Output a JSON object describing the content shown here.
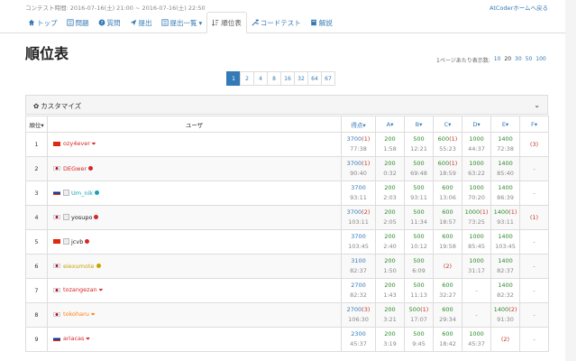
{
  "header": {
    "contest_time": "コンテスト時間: 2016-07-16(土) 21:00 ~ 2016-07-16(土) 22:50",
    "home_link": "AtCoderホームへ戻る"
  },
  "nav": [
    {
      "label": "トップ",
      "icon": "home-icon"
    },
    {
      "label": "問題",
      "icon": "list-icon"
    },
    {
      "label": "質問",
      "icon": "question-icon"
    },
    {
      "label": "提出",
      "icon": "send-icon"
    },
    {
      "label": "提出一覧",
      "icon": "list-icon",
      "dropdown": true
    },
    {
      "label": "順位表",
      "icon": "sort-icon",
      "active": true
    },
    {
      "label": "コードテスト",
      "icon": "wrench-icon"
    },
    {
      "label": "解説",
      "icon": "book-icon"
    }
  ],
  "page_title": "順位表",
  "perpage": {
    "label": "1ページあたり表示数:",
    "options": [
      "10",
      "20",
      "30",
      "50",
      "100"
    ],
    "current": "20"
  },
  "pagination": [
    "1",
    "2",
    "4",
    "8",
    "16",
    "32",
    "64",
    "67"
  ],
  "panel": {
    "title": "カスタマイズ"
  },
  "table": {
    "headers": [
      "順位",
      "ユーザ",
      "得点",
      "A",
      "B",
      "C",
      "D",
      "E",
      "F"
    ],
    "rows": [
      {
        "rank": "1",
        "flag": "cn",
        "user": "ozy4ever",
        "color": "#d62728",
        "mark": "heart",
        "score": "3700",
        "pen": "(1)",
        "time": "77:38",
        "cells": [
          [
            "200",
            "1:58",
            ""
          ],
          [
            "500",
            "12:21",
            ""
          ],
          [
            "600",
            "(1)",
            "55:23"
          ],
          [
            "1000",
            "44:37",
            ""
          ],
          [
            "1400",
            "72:38",
            ""
          ],
          [
            "(3)",
            "",
            ""
          ]
        ]
      },
      {
        "rank": "2",
        "flag": "jp",
        "user": "DEGwer",
        "color": "#d62728",
        "mark": "dot",
        "score": "3700",
        "pen": "(1)",
        "time": "90:40",
        "cells": [
          [
            "200",
            "0:32",
            ""
          ],
          [
            "500",
            "69:48",
            ""
          ],
          [
            "600",
            "(1)",
            "18:59"
          ],
          [
            "1000",
            "63:22",
            ""
          ],
          [
            "1400",
            "85:40",
            ""
          ],
          [
            "-",
            "",
            ""
          ]
        ]
      },
      {
        "rank": "3",
        "flag": "ru",
        "user": "Um_nik",
        "color": "#17a2b8",
        "mark": "dot",
        "avatar": true,
        "score": "3700",
        "pen": "",
        "time": "93:11",
        "cells": [
          [
            "200",
            "2:03",
            ""
          ],
          [
            "500",
            "93:11",
            ""
          ],
          [
            "600",
            "13:06",
            ""
          ],
          [
            "1000",
            "70:20",
            ""
          ],
          [
            "1400",
            "86:39",
            ""
          ],
          [
            "-",
            "",
            ""
          ]
        ]
      },
      {
        "rank": "4",
        "flag": "jp",
        "user": "yosupo",
        "color": "#222222",
        "mark": "dot",
        "avatar": true,
        "score": "3700",
        "pen": "(2)",
        "time": "103:11",
        "cells": [
          [
            "200",
            "2:05",
            ""
          ],
          [
            "500",
            "11:34",
            ""
          ],
          [
            "600",
            "18:57",
            ""
          ],
          [
            "1000",
            "(1)",
            "73:25"
          ],
          [
            "1400",
            "(1)",
            "93:11"
          ],
          [
            "(1)",
            "",
            ""
          ]
        ]
      },
      {
        "rank": "5",
        "flag": "cn",
        "user": "jcvb",
        "color": "#222222",
        "mark": "dot",
        "avatar": true,
        "score": "3700",
        "pen": "",
        "time": "103:45",
        "cells": [
          [
            "200",
            "2:40",
            ""
          ],
          [
            "500",
            "10:12",
            ""
          ],
          [
            "600",
            "19:58",
            ""
          ],
          [
            "1000",
            "85:45",
            ""
          ],
          [
            "1400",
            "103:45",
            ""
          ],
          [
            "-",
            "",
            ""
          ]
        ]
      },
      {
        "rank": "6",
        "flag": "jp",
        "user": "eiexumote",
        "color": "#c8a400",
        "mark": "dot",
        "score": "3100",
        "pen": "",
        "time": "82:37",
        "cells": [
          [
            "200",
            "1:50",
            ""
          ],
          [
            "500",
            "6:09",
            ""
          ],
          [
            "(2)",
            "",
            ""
          ],
          [
            "1000",
            "31:17",
            ""
          ],
          [
            "1400",
            "82:37",
            ""
          ],
          [
            "-",
            "",
            ""
          ]
        ]
      },
      {
        "rank": "7",
        "flag": "jp",
        "user": "tozangezan",
        "color": "#d62728",
        "mark": "heart",
        "score": "2700",
        "pen": "",
        "time": "82:32",
        "cells": [
          [
            "200",
            "1:43",
            ""
          ],
          [
            "500",
            "11:13",
            ""
          ],
          [
            "600",
            "32:27",
            ""
          ],
          [
            "-",
            "",
            ""
          ],
          [
            "1400",
            "82:32",
            ""
          ],
          [
            "-",
            "",
            ""
          ]
        ]
      },
      {
        "rank": "8",
        "flag": "jp",
        "user": "tokoharu",
        "color": "#ff7f0e",
        "mark": "heart",
        "score": "2700",
        "pen": "(3)",
        "time": "106:30",
        "cells": [
          [
            "200",
            "3:21",
            ""
          ],
          [
            "500",
            "(1)",
            "17:07"
          ],
          [
            "600",
            "29:34",
            ""
          ],
          [
            "-",
            "",
            ""
          ],
          [
            "1400",
            "(2)",
            "91:30"
          ],
          [
            "-",
            "",
            ""
          ]
        ]
      },
      {
        "rank": "9",
        "flag": "ru",
        "user": "ariacas",
        "color": "#d62728",
        "mark": "heart",
        "score": "2300",
        "pen": "",
        "time": "45:37",
        "cells": [
          [
            "200",
            "3:19",
            ""
          ],
          [
            "500",
            "9:45",
            ""
          ],
          [
            "600",
            "18:42",
            ""
          ],
          [
            "1000",
            "45:37",
            ""
          ],
          [
            "(2)",
            "",
            ""
          ],
          [
            "-",
            "",
            ""
          ]
        ]
      }
    ]
  },
  "colors": {
    "accent": "#337ab7",
    "ac": "#2b8a2b",
    "wa": "#c0392b"
  }
}
